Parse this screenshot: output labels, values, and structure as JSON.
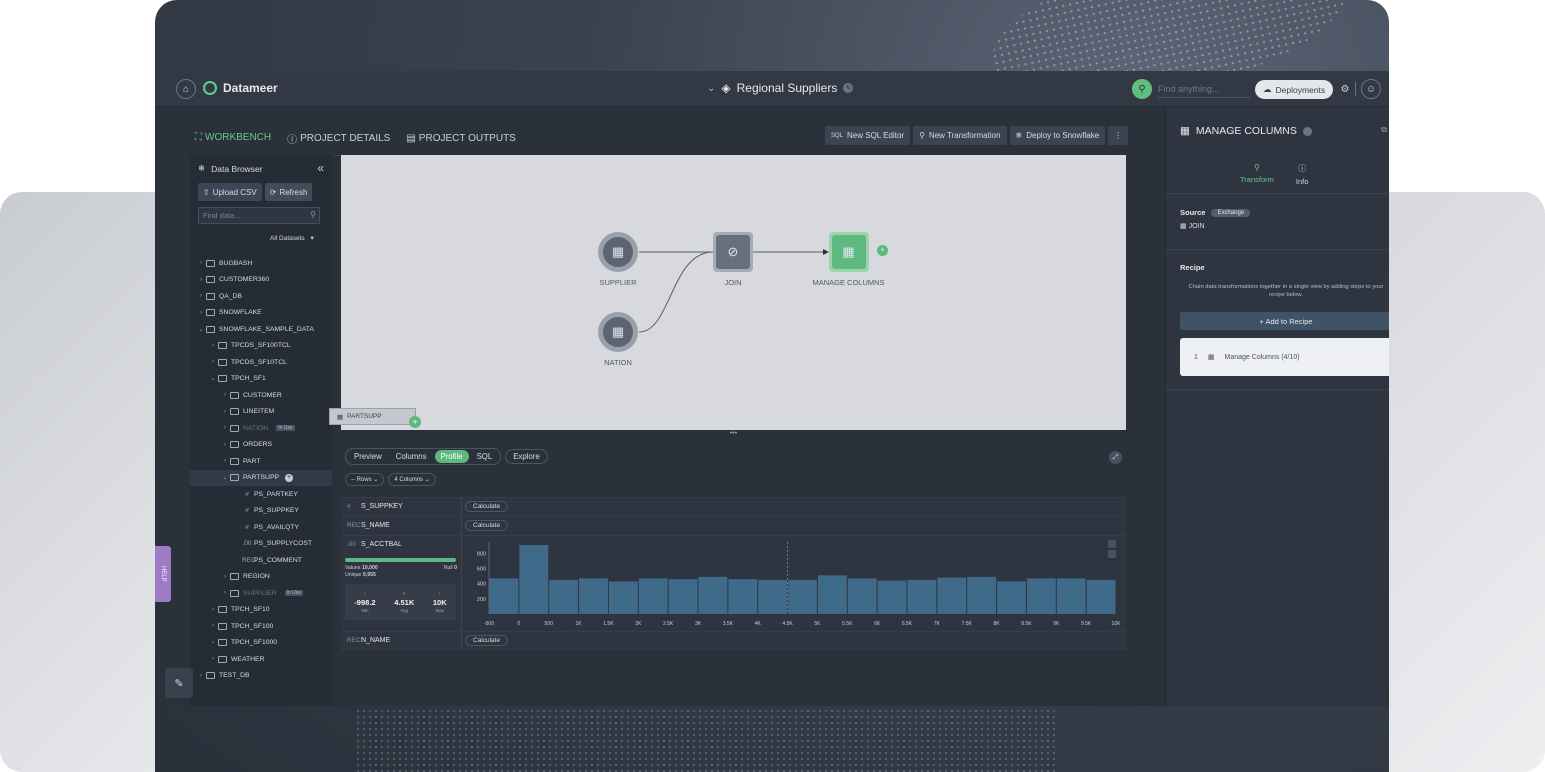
{
  "topbar": {
    "home_icon": "home-icon",
    "brand": "Datameer",
    "project_title": "Regional Suppliers",
    "search_placeholder": "Find anything...",
    "deployments_label": "Deployments"
  },
  "tabs": [
    {
      "label": "WORKBENCH",
      "icon": "workbench-icon",
      "active": true
    },
    {
      "label": "PROJECT DETAILS",
      "icon": "info-icon",
      "active": false
    },
    {
      "label": "PROJECT OUTPUTS",
      "icon": "outputs-icon",
      "active": false
    }
  ],
  "toolbar": {
    "new_sql": "New SQL Editor",
    "new_transformation": "New Transformation",
    "deploy": "Deploy to Snowflake"
  },
  "sidebar": {
    "title": "Data Browser",
    "upload": "Upload CSV",
    "refresh": "Refresh",
    "find_placeholder": "Find data...",
    "filter": "All Datasets",
    "tree": [
      {
        "label": "BUGBASH",
        "level": 0,
        "chev": ">",
        "kind": "db"
      },
      {
        "label": "CUSTOMER360",
        "level": 0,
        "chev": ">",
        "kind": "db"
      },
      {
        "label": "QA_DB",
        "level": 0,
        "chev": ">",
        "kind": "db"
      },
      {
        "label": "SNOWFLAKE",
        "level": 0,
        "chev": ">",
        "kind": "db"
      },
      {
        "label": "SNOWFLAKE_SAMPLE_DATA",
        "level": 0,
        "chev": "v",
        "kind": "db"
      },
      {
        "label": "TPCDS_SF100TCL",
        "level": 1,
        "chev": ">",
        "kind": "schema"
      },
      {
        "label": "TPCDS_SF10TCL",
        "level": 1,
        "chev": ">",
        "kind": "schema"
      },
      {
        "label": "TPCH_SF1",
        "level": 1,
        "chev": "v",
        "kind": "schema"
      },
      {
        "label": "CUSTOMER",
        "level": 2,
        "chev": ">",
        "kind": "table"
      },
      {
        "label": "LINEITEM",
        "level": 2,
        "chev": ">",
        "kind": "table"
      },
      {
        "label": "NATION",
        "level": 2,
        "chev": ">",
        "kind": "table",
        "dim": true,
        "tag": "In Use"
      },
      {
        "label": "ORDERS",
        "level": 2,
        "chev": ">",
        "kind": "table"
      },
      {
        "label": "PART",
        "level": 2,
        "chev": ">",
        "kind": "table"
      },
      {
        "label": "PARTSUPP",
        "level": 2,
        "chev": "v",
        "kind": "table",
        "active": true
      },
      {
        "label": "PS_PARTKEY",
        "level": 3,
        "chev": "",
        "kind": "col",
        "type": "#"
      },
      {
        "label": "PS_SUPPKEY",
        "level": 3,
        "chev": "",
        "kind": "col",
        "type": "#"
      },
      {
        "label": "PS_AVAILQTY",
        "level": 3,
        "chev": "",
        "kind": "col",
        "type": "#"
      },
      {
        "label": "PS_SUPPLYCOST",
        "level": 3,
        "chev": "",
        "kind": "col",
        "type": ".00"
      },
      {
        "label": "PS_COMMENT",
        "level": 3,
        "chev": "",
        "kind": "col",
        "type": "REC"
      },
      {
        "label": "REGION",
        "level": 2,
        "chev": ">",
        "kind": "table"
      },
      {
        "label": "SUPPLIER",
        "level": 2,
        "chev": ">",
        "kind": "table",
        "dim": true,
        "tag": "In Use"
      },
      {
        "label": "TPCH_SF10",
        "level": 1,
        "chev": ">",
        "kind": "schema"
      },
      {
        "label": "TPCH_SF100",
        "level": 1,
        "chev": ">",
        "kind": "schema"
      },
      {
        "label": "TPCH_SF1000",
        "level": 1,
        "chev": ">",
        "kind": "schema"
      },
      {
        "label": "WEATHER",
        "level": 1,
        "chev": ">",
        "kind": "schema"
      },
      {
        "label": "TEST_DB",
        "level": 0,
        "chev": ">",
        "kind": "db"
      }
    ],
    "help": "HELP"
  },
  "canvas": {
    "nodes": {
      "supplier": "SUPPLIER",
      "nation": "NATION",
      "join": "JOIN",
      "manage": "MANAGE COLUMNS"
    },
    "drag_chip": "PARTSUPP"
  },
  "bottom": {
    "tabs_group": [
      "Preview",
      "Columns",
      "Profile",
      "SQL"
    ],
    "active_tab": "Profile",
    "explore": "Explore",
    "filter_rows": "-- Rows",
    "filter_cols": "4 Columns",
    "columns": [
      {
        "type": "#",
        "name": "S_SUPPKEY",
        "action": "Calculate"
      },
      {
        "type": "REC",
        "name": "S_NAME",
        "action": "Calculate"
      },
      {
        "type": ".00",
        "name": "S_ACCTBAL"
      },
      {
        "type": "REC",
        "name": "N_NAME",
        "action": "Calculate"
      }
    ],
    "stats": {
      "values_label": "Values",
      "values": "10,000",
      "null_label": "Null",
      "null": "0",
      "unique_label": "Unique",
      "unique": "9,955",
      "min": "-998.2",
      "min_label": "Min",
      "avg": "4.51K",
      "avg_label": "Avg",
      "max": "10K",
      "max_label": "Max"
    }
  },
  "chart_data": {
    "type": "bar",
    "categories": [
      "-500",
      "0",
      "500",
      "1K",
      "1.5K",
      "2K",
      "2.5K",
      "3K",
      "3.5K",
      "4K",
      "4.5K",
      "5K",
      "5.5K",
      "6K",
      "6.5K",
      "7K",
      "7.5K",
      "8K",
      "8.5K",
      "9K",
      "9.5K"
    ],
    "x_tick_labels": [
      "-500",
      "0",
      "500",
      "1K",
      "1.5K",
      "2K",
      "2.5K",
      "3K",
      "3.5K",
      "4K",
      "4.5K",
      "5K",
      "5.5K",
      "6K",
      "6.5K",
      "7K",
      "7.5K",
      "8K",
      "8.5K",
      "9K",
      "9.5K",
      "10K"
    ],
    "values": [
      470,
      910,
      450,
      470,
      430,
      470,
      460,
      490,
      460,
      450,
      450,
      510,
      470,
      440,
      450,
      480,
      490,
      430,
      470,
      470,
      450
    ],
    "y_ticks": [
      200,
      400,
      600,
      800
    ],
    "ylim": [
      0,
      950
    ],
    "marker_x": "4.5K",
    "bar_color": "#3f6a8a"
  },
  "right_panel": {
    "title": "MANAGE COLUMNS",
    "tabs": [
      {
        "label": "Transform",
        "active": true
      },
      {
        "label": "Info",
        "active": false
      }
    ],
    "source_label": "Source",
    "source_chip": "Exchange",
    "source_value": "JOIN",
    "recipe_title": "Recipe",
    "recipe_desc": "Chain data transformations together in a single view by adding steps to your recipe below.",
    "add_recipe": "+ Add to Recipe",
    "recipe_step_num": "1",
    "recipe_step": "Manage Columns (4/10)"
  }
}
